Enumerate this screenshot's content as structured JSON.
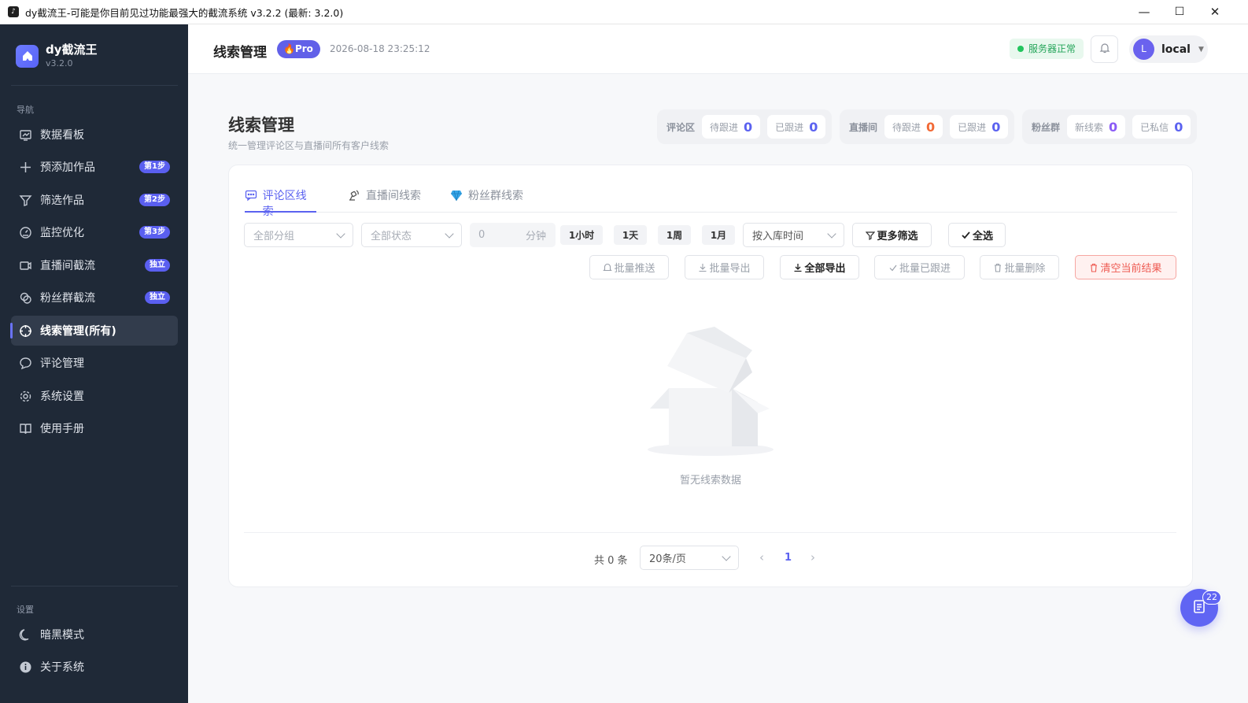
{
  "window": {
    "title": "dy截流王-可能是你目前见过功能最强大的截流系统 v3.2.2 (最新: 3.2.0)",
    "controls": {
      "minimize": "—",
      "maximize": "☐",
      "close": "✕"
    }
  },
  "sidebar": {
    "brand_name": "dy截流王",
    "brand_version": "v3.2.0",
    "nav_section": "导航",
    "settings_section": "设置",
    "items": [
      {
        "label": "数据看板",
        "badge": "",
        "icon": "dashboard-icon"
      },
      {
        "label": "预添加作品",
        "badge": "第1步",
        "icon": "plus-icon"
      },
      {
        "label": "筛选作品",
        "badge": "第2步",
        "icon": "filter-icon"
      },
      {
        "label": "监控优化",
        "badge": "第3步",
        "icon": "gauge-icon"
      },
      {
        "label": "直播间截流",
        "badge": "独立",
        "icon": "video-icon"
      },
      {
        "label": "粉丝群截流",
        "badge": "独立",
        "icon": "link-icon"
      },
      {
        "label": "线索管理(所有)",
        "badge": "",
        "icon": "crosshair-icon",
        "active": true
      },
      {
        "label": "评论管理",
        "badge": "",
        "icon": "comment-icon"
      },
      {
        "label": "系统设置",
        "badge": "",
        "icon": "gear-icon"
      },
      {
        "label": "使用手册",
        "badge": "",
        "icon": "book-icon"
      }
    ],
    "settings_items": [
      {
        "label": "暗黑模式",
        "icon": "moon-icon"
      },
      {
        "label": "关于系统",
        "icon": "info-icon"
      }
    ]
  },
  "header": {
    "title": "线索管理",
    "pro_label": "Pro",
    "datetime": "2026-08-18 23:25:12",
    "server_status": "服务器正常",
    "user_initial": "L",
    "user_name": "local"
  },
  "page": {
    "title": "线索管理",
    "subtitle": "统一管理评论区与直播间所有客户线索",
    "stat_groups": [
      {
        "label": "评论区",
        "chips": [
          {
            "label": "待跟进",
            "value": "0",
            "color": "#5b62f0"
          },
          {
            "label": "已跟进",
            "value": "0",
            "color": "#5b62f0"
          }
        ]
      },
      {
        "label": "直播间",
        "chips": [
          {
            "label": "待跟进",
            "value": "0",
            "color": "#f26a36"
          },
          {
            "label": "已跟进",
            "value": "0",
            "color": "#5b62f0"
          }
        ]
      },
      {
        "label": "粉丝群",
        "chips": [
          {
            "label": "新线索",
            "value": "0",
            "color": "#8b5cf6"
          },
          {
            "label": "已私信",
            "value": "0",
            "color": "#5b62f0"
          }
        ]
      }
    ]
  },
  "tabs": [
    {
      "label": "评论区线索",
      "icon": "comment-icon",
      "active": true
    },
    {
      "label": "直播间线索",
      "icon": "broadcast-icon"
    },
    {
      "label": "粉丝群线索",
      "icon": "diamond-icon"
    }
  ],
  "filters": {
    "group_placeholder": "全部分组",
    "status_placeholder": "全部状态",
    "minutes_value": "0",
    "minutes_unit": "分钟",
    "quick_ranges": [
      "1小时",
      "1天",
      "1周",
      "1月"
    ],
    "sort_placeholder": "按入库时间",
    "more_filters": "更多筛选",
    "select_all": "全选"
  },
  "actions": {
    "batch_push": "批量推送",
    "batch_export": "批量导出",
    "export_all": "全部导出",
    "batch_followed": "批量已跟进",
    "batch_delete": "批量删除",
    "clear_results": "清空当前结果"
  },
  "empty": {
    "text": "暂无线索数据"
  },
  "pagination": {
    "total": "共 0 条",
    "page_size": "20条/页",
    "current_page": "1"
  },
  "float_button": {
    "badge": "22"
  },
  "colors": {
    "accent": "#5b62f0",
    "sidebar_bg": "#1f2937",
    "success": "#22c55e",
    "danger": "#ee5a52"
  }
}
